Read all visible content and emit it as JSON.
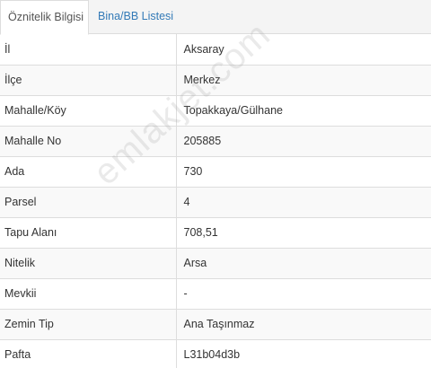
{
  "tabs": [
    {
      "label": "Öznitelik Bilgisi",
      "active": true
    },
    {
      "label": "Bina/BB Listesi",
      "active": false
    }
  ],
  "rows": [
    {
      "key": "İl",
      "value": "Aksaray"
    },
    {
      "key": "İlçe",
      "value": "Merkez"
    },
    {
      "key": "Mahalle/Köy",
      "value": "Topakkaya/Gülhane"
    },
    {
      "key": "Mahalle No",
      "value": "205885"
    },
    {
      "key": "Ada",
      "value": "730"
    },
    {
      "key": "Parsel",
      "value": "4"
    },
    {
      "key": "Tapu Alanı",
      "value": "708,51"
    },
    {
      "key": "Nitelik",
      "value": "Arsa"
    },
    {
      "key": "Mevkii",
      "value": "-"
    },
    {
      "key": "Zemin Tip",
      "value": "Ana Taşınmaz"
    },
    {
      "key": "Pafta",
      "value": "L31b04d3b"
    }
  ],
  "watermark": "emlakjet.com",
  "colors": {
    "link": "#337ab7",
    "border": "#dddddd",
    "stripe": "#f9f9f9",
    "tabbar_bg": "#f4f4f4"
  }
}
